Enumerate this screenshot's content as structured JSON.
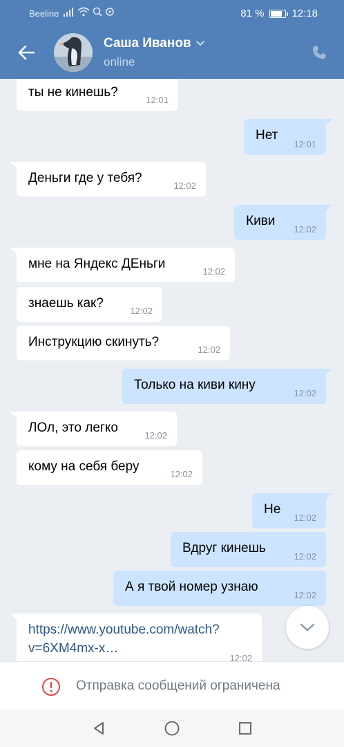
{
  "status_bar": {
    "carrier": "Beeline",
    "battery_percent": "81 %",
    "battery_level": 0.81,
    "time": "12:18"
  },
  "header": {
    "back_icon": "arrow-left-icon",
    "contact_name": "Саша Иванов",
    "contact_status": "online",
    "dropdown_icon": "chevron-down-icon",
    "call_icon": "phone-icon"
  },
  "messages": [
    {
      "direction": "in",
      "text": "ты не кинешь?",
      "time": "12:01"
    },
    {
      "direction": "out",
      "text": "Нет",
      "time": "12:01"
    },
    {
      "direction": "in",
      "text": "Деньги где у тебя?",
      "time": "12:02"
    },
    {
      "direction": "out",
      "text": "Киви",
      "time": "12:02"
    },
    {
      "direction": "in",
      "text": "мне на Яндекс ДЕньги",
      "time": "12:02"
    },
    {
      "direction": "in",
      "text": "знаешь как?",
      "time": "12:02"
    },
    {
      "direction": "in",
      "text": "Инструкцию скинуть?",
      "time": "12:02"
    },
    {
      "direction": "out",
      "text": "Только на киви кину",
      "time": "12:02"
    },
    {
      "direction": "in",
      "text": "ЛОл, это легко",
      "time": "12:02"
    },
    {
      "direction": "in",
      "text": "кому на себя беру",
      "time": "12:02"
    },
    {
      "direction": "out",
      "text": "Не",
      "time": "12:02"
    },
    {
      "direction": "out",
      "text": "Вдруг кинешь",
      "time": "12:02"
    },
    {
      "direction": "out",
      "text": "А я твой номер узнаю",
      "time": "12:02"
    },
    {
      "direction": "in",
      "text": "https://www.youtube.com/watch?v=6XM4mx-x…",
      "time": "12:02"
    }
  ],
  "scroll_down_icon": "chevron-down-icon",
  "footer": {
    "icon": "exclamation-circle-icon",
    "text": "Отправка сообщений ограничена"
  },
  "navbar": {
    "back_icon": "triangle-back-icon",
    "home_icon": "circle-home-icon",
    "recents_icon": "square-recents-icon"
  },
  "colors": {
    "header": "#5181b8",
    "background": "#ebeff4",
    "incoming_bubble": "#ffffff",
    "outgoing_bubble": "#cce4ff",
    "link": "#2a5885",
    "warning": "#e64646"
  }
}
